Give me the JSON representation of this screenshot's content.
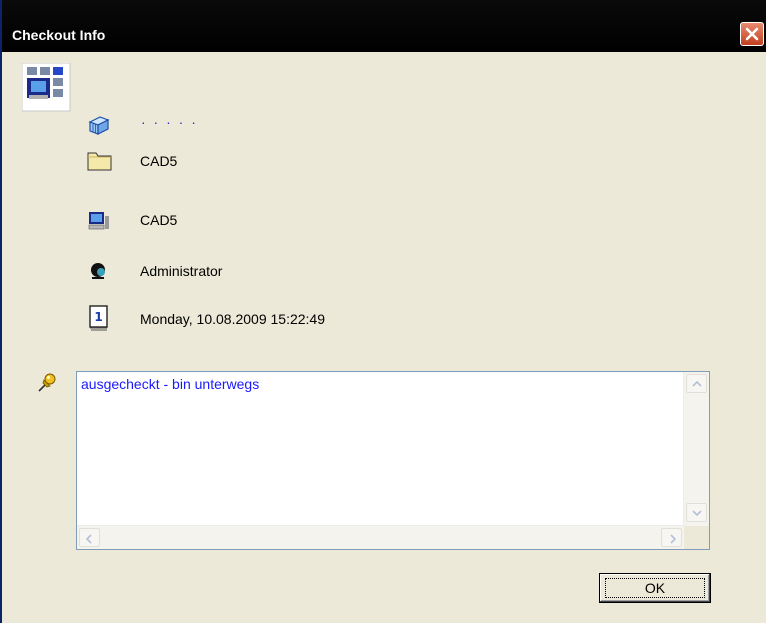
{
  "window": {
    "title": "Checkout Info"
  },
  "info": {
    "placeholder_dots": "· · · · ·",
    "folder": "CAD5",
    "computer": "CAD5",
    "user": "Administrator",
    "datetime": "Monday, 10.08.2009   15:22:49"
  },
  "memo": {
    "text": "ausgecheckt - bin unterwegs"
  },
  "buttons": {
    "ok_label": "OK"
  },
  "icons": {
    "app": "checkout-app-icon",
    "part": "3d-part-icon",
    "folder": "folder-icon",
    "computer": "computer-icon",
    "user": "user-icon",
    "calendar": "calendar-icon",
    "pin": "pushpin-icon",
    "close": "close-icon"
  },
  "colors": {
    "memo_text": "#1a1aff",
    "dots": "#3030d0",
    "close_button": "#c0401f"
  }
}
